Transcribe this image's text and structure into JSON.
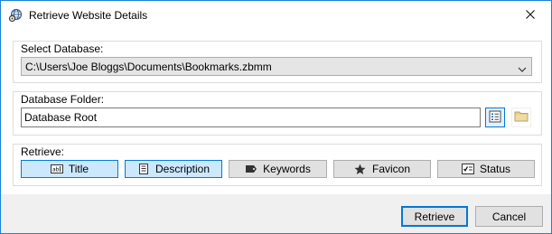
{
  "window": {
    "title": "Retrieve Website Details",
    "app_icon": "globe-gear-icon",
    "close_icon": "close-icon",
    "accent_color": "#0078d7"
  },
  "database": {
    "label": "Select Database:",
    "value": "C:\\Users\\Joe Bloggs\\Documents\\Bookmarks.zbmm",
    "dropdown_icon": "chevron-down-icon"
  },
  "folder": {
    "label": "Database Folder:",
    "value": "Database Root",
    "browse_icon": "folder-list-icon",
    "open_icon": "folder-icon"
  },
  "retrieve": {
    "label": "Retrieve:",
    "options": [
      {
        "label": "Title",
        "icon": "text-field-icon",
        "selected": true
      },
      {
        "label": "Description",
        "icon": "document-icon",
        "selected": true
      },
      {
        "label": "Keywords",
        "icon": "tag-icon",
        "selected": false
      },
      {
        "label": "Favicon",
        "icon": "star-icon",
        "selected": false
      },
      {
        "label": "Status",
        "icon": "checklist-icon",
        "selected": false
      }
    ]
  },
  "buttons": {
    "retrieve": "Retrieve",
    "cancel": "Cancel"
  }
}
